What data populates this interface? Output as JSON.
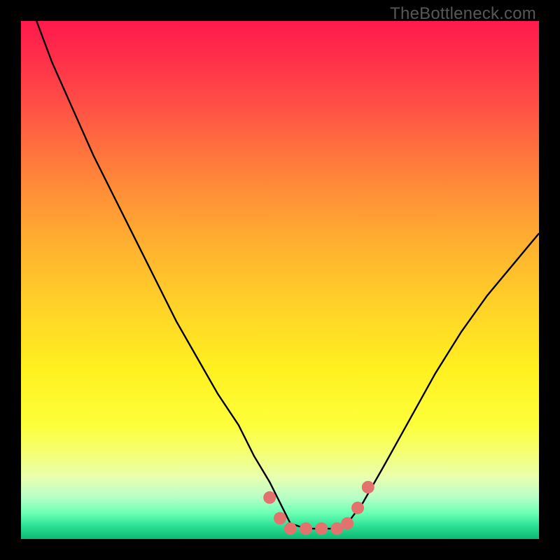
{
  "watermark": "TheBottleneck.com",
  "colors": {
    "frame": "#000000",
    "curve": "#000000",
    "dot_fill": "#e3726e",
    "gradient_top": "#ff1a4d",
    "gradient_mid": "#ffd228",
    "gradient_bottom": "#1ed186"
  },
  "chart_data": {
    "type": "line",
    "title": "",
    "xlabel": "",
    "ylabel": "",
    "xlim": [
      0,
      100
    ],
    "ylim": [
      0,
      100
    ],
    "grid": false,
    "legend": false,
    "notes": "V-shaped bottleneck curve plotted on a vertical red→yellow→green gradient. y≈0 indicates optimal (green), higher y indicates worse (red). The flat basin around x 52–63 is highlighted with salmon dots.",
    "series": [
      {
        "name": "bottleneck-curve",
        "x": [
          3,
          6,
          10,
          14,
          18,
          22,
          26,
          30,
          34,
          38,
          42,
          45,
          48,
          50,
          52,
          55,
          58,
          61,
          63,
          66,
          70,
          75,
          80,
          85,
          90,
          95,
          100
        ],
        "y": [
          100,
          92,
          83,
          74,
          66,
          58,
          50,
          42,
          35,
          28,
          22,
          16,
          11,
          7,
          3,
          2,
          2,
          2,
          3,
          7,
          14,
          23,
          32,
          40,
          47,
          53,
          59
        ]
      }
    ],
    "highlight_points": {
      "name": "optimal-band",
      "x": [
        48,
        50,
        52,
        55,
        58,
        61,
        63,
        65,
        67
      ],
      "y": [
        8,
        4,
        2,
        2,
        2,
        2,
        3,
        6,
        10
      ]
    }
  }
}
